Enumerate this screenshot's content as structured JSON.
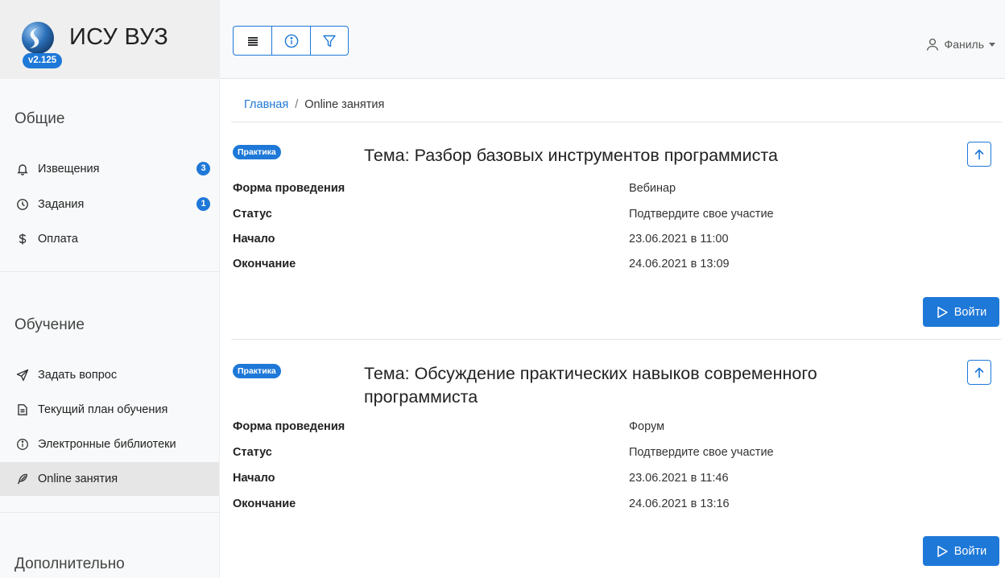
{
  "brand": {
    "title": "ИСУ ВУЗ",
    "version": "v2.125",
    "accent_color": "#1e78d8"
  },
  "sidebar": {
    "sections": [
      {
        "title": "Общие",
        "items": [
          {
            "label": "Извещения",
            "icon": "bell-icon",
            "badge": "3"
          },
          {
            "label": "Задания",
            "icon": "clock-icon",
            "badge": "1"
          },
          {
            "label": "Оплата",
            "icon": "dollar-icon"
          }
        ]
      },
      {
        "title": "Обучение",
        "items": [
          {
            "label": "Задать вопрос",
            "icon": "send-icon"
          },
          {
            "label": "Текущий план обучения",
            "icon": "document-icon"
          },
          {
            "label": "Электронные библиотеки",
            "icon": "info-icon"
          },
          {
            "label": "Online занятия",
            "icon": "feather-icon",
            "active": true
          }
        ]
      },
      {
        "title": "Дополнительно",
        "items": []
      }
    ]
  },
  "toolbar": {
    "buttons": [
      {
        "icon": "menu-list-icon"
      },
      {
        "icon": "info-icon"
      },
      {
        "icon": "filter-icon"
      }
    ]
  },
  "user": {
    "name": "Фаниль",
    "icon": "user-icon"
  },
  "breadcrumb": {
    "home": "Главная",
    "separator": "/",
    "current": "Online занятия"
  },
  "sessions": [
    {
      "badge": "Практика",
      "title": "Тема: Разбор базовых инструментов программиста",
      "fields": [
        {
          "label": "Форма проведения",
          "value": "Вебинар"
        },
        {
          "label": "Статус",
          "value": "Подтвердите свое участие"
        },
        {
          "label": "Начало",
          "value": "23.06.2021 в 11:00"
        },
        {
          "label": "Окончание",
          "value": "24.06.2021 в 13:09"
        }
      ],
      "join_label": "Войти"
    },
    {
      "badge": "Практика",
      "title": "Тема: Обсуждение практических навыков современного программиста",
      "fields": [
        {
          "label": "Форма проведения",
          "value": "Форум"
        },
        {
          "label": "Статус",
          "value": "Подтвердите свое участие"
        },
        {
          "label": "Начало",
          "value": "23.06.2021 в 11:46"
        },
        {
          "label": "Окончание",
          "value": "24.06.2021 в 13:16"
        }
      ],
      "join_label": "Войти"
    }
  ]
}
